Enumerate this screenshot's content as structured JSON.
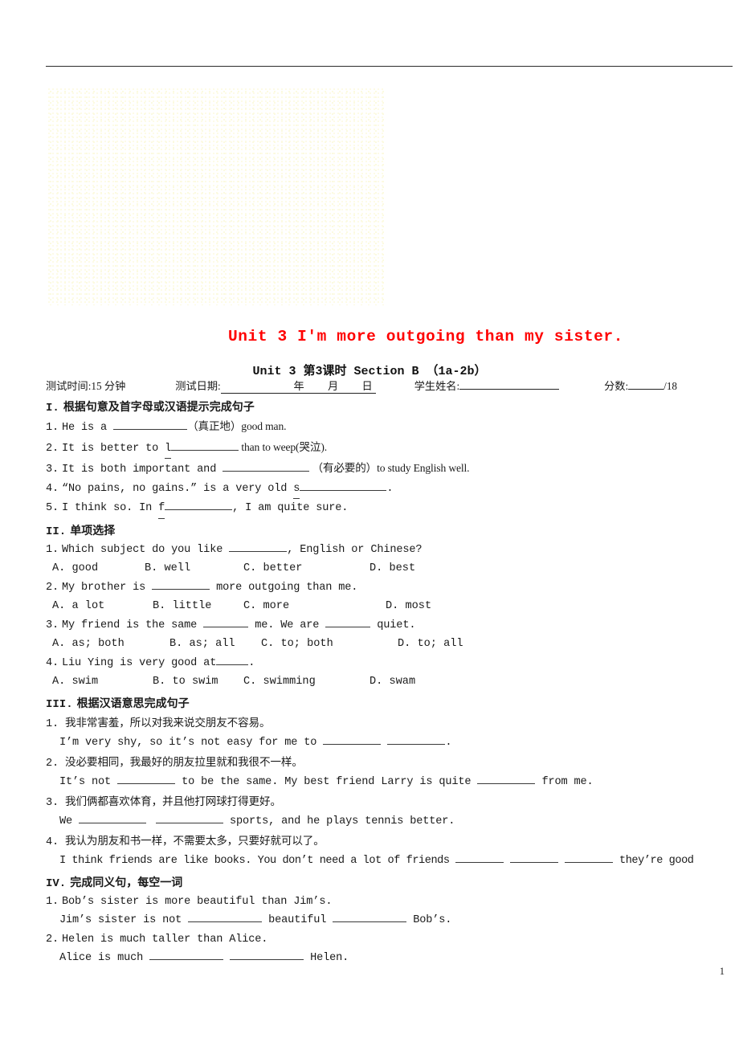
{
  "document": {
    "title": "Unit 3 I'm more outgoing than my sister.",
    "subtitle": "Unit 3 第3课时 Section B （1a-2b）",
    "page_number": "1",
    "title_color": "#ff0000"
  },
  "meta": {
    "time_label": "测试时间:15 分钟",
    "date_label": "测试日期:",
    "date_year": "年",
    "date_month": "月",
    "date_day": "日",
    "name_label": "学生姓名:",
    "score_label": "分数:",
    "score_total": "/18"
  },
  "sections": [
    {
      "numeral": "I.",
      "heading": "根据句意及首字母或汉语提示完成句子",
      "items": [
        {
          "num": "1.",
          "pre": "He is a ",
          "blank": 92,
          "post": "（真正地）good man."
        },
        {
          "num": "2.",
          "pre": "It is better to ",
          "hint": "l",
          "blank": 84,
          "post": " than to weep(哭泣)."
        },
        {
          "num": "3.",
          "pre": "It is both important and ",
          "blank": 108,
          "post": " （有必要的）to study English well."
        },
        {
          "num": "4.",
          "pre": "“No pains, no gains.” is a very old ",
          "hint": "s",
          "blank": 108,
          "post": "."
        },
        {
          "num": "5.",
          "pre": "I think so. In ",
          "hint": "f",
          "blank": 84,
          "post": ", I am quite sure."
        }
      ]
    },
    {
      "numeral": "II.",
      "heading": "单项选择",
      "questions": [
        {
          "num": "1.",
          "stem_pre": "Which subject do you like ",
          "stem_blank": 72,
          "stem_post": ", English or Chinese?",
          "options": [
            "A. good",
            "B. well",
            "C. better",
            "D. best"
          ],
          "option_offsets": [
            30,
            145,
            268,
            425
          ]
        },
        {
          "num": "2.",
          "stem_pre": "My brother is ",
          "stem_blank": 72,
          "stem_post": " more outgoing than me.",
          "options": [
            "A. a lot",
            "B. little",
            "C. more",
            "D. most"
          ],
          "option_offsets": [
            30,
            155,
            268,
            445
          ]
        },
        {
          "num": "3.",
          "stem_pre": "My friend is the same ",
          "stem_blank": 56,
          "stem_mid": " me. We are ",
          "stem_blank2": 56,
          "stem_post": " quiet.",
          "options": [
            "A. as; both",
            "B. as; all",
            "C. to; both",
            "D. to; all"
          ],
          "option_offsets": [
            30,
            176,
            290,
            460
          ]
        },
        {
          "num": "4.",
          "stem_pre": "Liu Ying is very good at",
          "stem_blank": 40,
          "stem_post": ".",
          "options": [
            "A. swim",
            "B. to swim",
            "C. swimming",
            "D. swam"
          ],
          "option_offsets": [
            30,
            155,
            268,
            425
          ]
        }
      ]
    },
    {
      "numeral": "III.",
      "heading": "根据汉语意思完成句子",
      "items": [
        {
          "num": "1.",
          "chinese": "我非常害羞，所以对我来说交朋友不容易。",
          "english_pre": "I’m very shy, so it’s not easy for me to ",
          "blanks": [
            72,
            72
          ],
          "english_post": "."
        },
        {
          "num": "2.",
          "chinese": "没必要相同，我最好的朋友拉里就和我很不一样。",
          "english_pre": "It’s not ",
          "blanks": [
            72
          ],
          "english_mid": " to be the same. My best friend Larry is quite ",
          "blanks2": [
            72
          ],
          "english_post": " from me."
        },
        {
          "num": "3.",
          "chinese": "我们俩都喜欢体育，并且他打网球打得更好。",
          "english_pre": "We ",
          "blanks": [
            84,
            84
          ],
          "english_post": " sports, and he plays tennis better."
        },
        {
          "num": "4.",
          "chinese": "我认为朋友和书一样，不需要太多，只要好就可以了。",
          "english_pre": "I think friends are like books. You don’t need a lot of friends ",
          "blanks": [
            60,
            60,
            60
          ],
          "english_post": " they’re good"
        }
      ]
    },
    {
      "numeral": "IV.",
      "heading": "完成同义句，每空一词",
      "items": [
        {
          "num": "1.",
          "original": "Bob’s sister is more beautiful than Jim’s.",
          "answer_pre": "Jim’s sister is not ",
          "blanks": [
            92
          ],
          "answer_mid": " beautiful ",
          "blanks2": [
            92
          ],
          "answer_post": " Bob’s."
        },
        {
          "num": "2.",
          "original": "Helen is much taller than Alice.",
          "answer_pre": "Alice is much ",
          "blanks": [
            92,
            92
          ],
          "answer_post": " Helen."
        }
      ]
    }
  ]
}
